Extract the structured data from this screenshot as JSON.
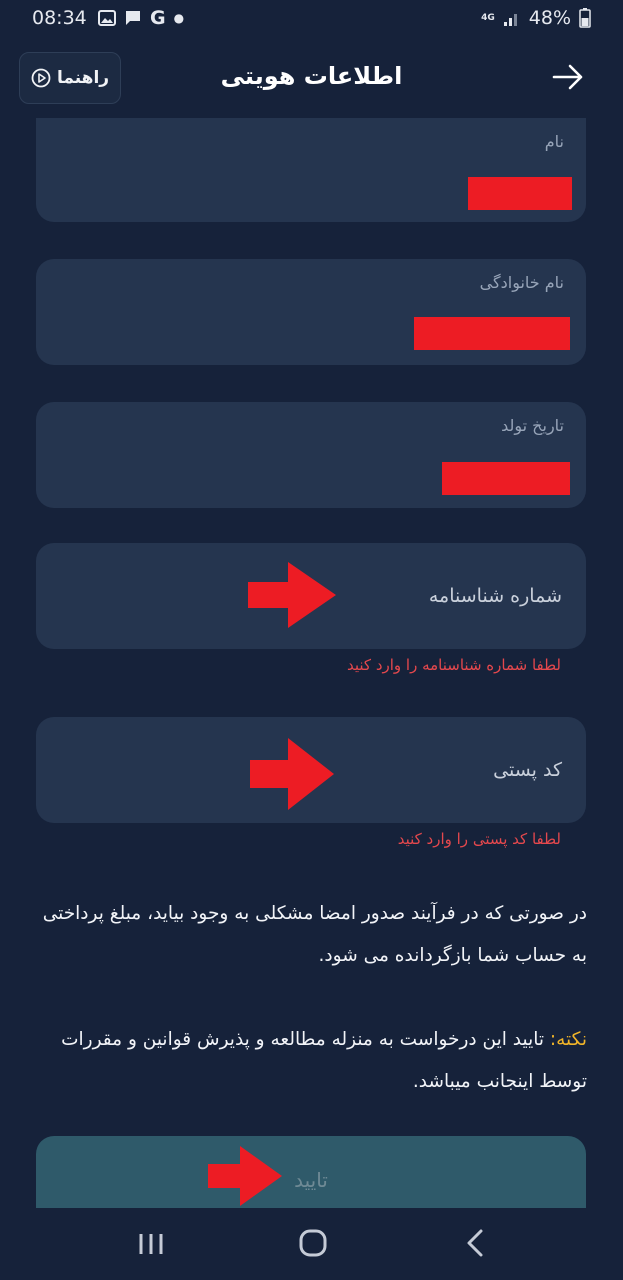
{
  "status": {
    "time": "08:34",
    "network": "4G",
    "battery": "48%"
  },
  "header": {
    "help_label": "راهنما",
    "title": "اطلاعات هویتی"
  },
  "fields": {
    "first_name": {
      "label": "نام"
    },
    "last_name": {
      "label": "نام خانوادگی"
    },
    "birth_date": {
      "label": "تاریخ تولد"
    },
    "birth_cert": {
      "placeholder": "شماره شناسنامه",
      "error": "لطفا شماره شناسنامه را وارد کنید"
    },
    "postal_code": {
      "placeholder": "کد پستی",
      "error": "لطفا کد پستی را وارد کنید"
    }
  },
  "info": {
    "refund_text": "در صورتی که در فرآیند صدور امضا مشکلی به وجود بیاید، مبلغ پرداختی به حساب شما بازگردانده می شود.",
    "note_label": "نکته:",
    "note_text": " تایید این درخواست به منزله مطالعه و پذیرش قوانین و مقررات توسط اینجانب میباشد."
  },
  "actions": {
    "confirm_label": "تایید"
  },
  "colors": {
    "background": "#16223a",
    "field": "#25354f",
    "error": "#e5484d",
    "note": "#f0b429",
    "redaction": "#ed1c24",
    "annotation_arrow": "#ed1c24"
  },
  "icons": [
    "photo-icon",
    "message-icon",
    "google-icon",
    "signal-icon",
    "battery-icon",
    "play-circle-icon",
    "arrow-right-icon",
    "recents-icon",
    "home-icon",
    "back-icon"
  ]
}
